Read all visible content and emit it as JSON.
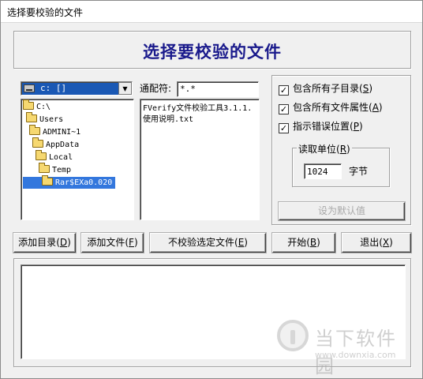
{
  "window": {
    "title": "选择要校验的文件"
  },
  "header": {
    "title": "选择要校验的文件"
  },
  "drive": {
    "label": "c: []",
    "icon": "drive-icon"
  },
  "directories": [
    {
      "name": "C:\\",
      "selected": false
    },
    {
      "name": "Users",
      "selected": false
    },
    {
      "name": "ADMINI~1",
      "selected": false
    },
    {
      "name": "AppData",
      "selected": false
    },
    {
      "name": "Local",
      "selected": false
    },
    {
      "name": "Temp",
      "selected": false
    },
    {
      "name": "Rar$EXa0.020",
      "selected": true
    }
  ],
  "filter": {
    "label": "通配符:",
    "value": "*.*"
  },
  "files": [
    "FVerify文件校验工具3.1.1.",
    "使用说明.txt"
  ],
  "options": [
    {
      "label": "包含所有子目录",
      "hotkey": "S",
      "checked": true
    },
    {
      "label": "包含所有文件属性",
      "hotkey": "A",
      "checked": true
    },
    {
      "label": "指示错误位置",
      "hotkey": "P",
      "checked": true
    }
  ],
  "read_unit": {
    "caption": "读取单位",
    "hotkey": "R",
    "value": "1024",
    "unit_label": "字节"
  },
  "buttons": {
    "set_default": "设为默认值",
    "add_dir": "添加目录",
    "add_dir_key": "D",
    "add_file": "添加文件",
    "add_file_key": "F",
    "exclude": "不校验选定文件",
    "exclude_key": "E",
    "start": "开始",
    "start_key": "B",
    "exit": "退出",
    "exit_key": "X"
  },
  "watermark": {
    "brand": "当下软件园",
    "url": "www.downxia.com"
  }
}
